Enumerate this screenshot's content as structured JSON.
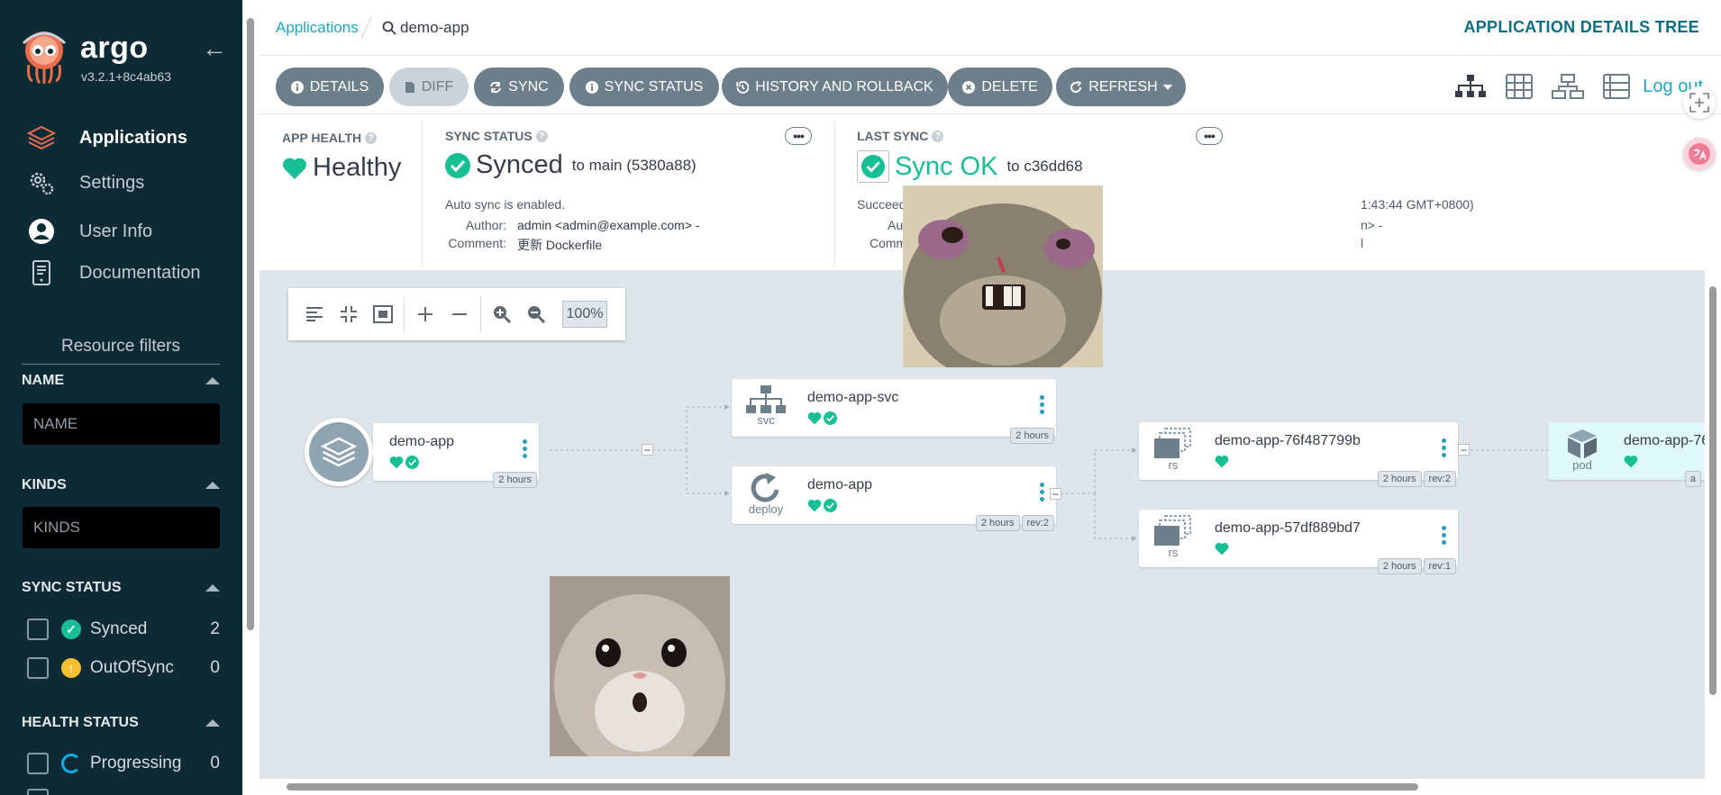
{
  "sidebar": {
    "brand": "argo",
    "version": "v3.2.1+8c4ab63",
    "nav": [
      {
        "label": "Applications"
      },
      {
        "label": "Settings"
      },
      {
        "label": "User Info"
      },
      {
        "label": "Documentation"
      }
    ],
    "filters_title": "Resource filters",
    "name_filter": {
      "heading": "NAME",
      "placeholder": "NAME"
    },
    "kinds_filter": {
      "heading": "KINDS",
      "placeholder": "KINDS"
    },
    "sync_status": {
      "heading": "SYNC STATUS",
      "items": [
        {
          "label": "Synced",
          "count": "2"
        },
        {
          "label": "OutOfSync",
          "count": "0"
        }
      ]
    },
    "health_status": {
      "heading": "HEALTH STATUS",
      "items": [
        {
          "label": "Progressing",
          "count": "0"
        }
      ]
    }
  },
  "topbar": {
    "breadcrumb_link": "Applications",
    "current_app": "demo-app",
    "heading": "APPLICATION DETAILS TREE"
  },
  "toolbar": {
    "buttons": [
      "DETAILS",
      "DIFF",
      "SYNC",
      "SYNC STATUS",
      "HISTORY AND ROLLBACK",
      "DELETE",
      "REFRESH"
    ],
    "logout": "Log out"
  },
  "status": {
    "health": {
      "label": "APP HEALTH",
      "value": "Healthy"
    },
    "sync": {
      "label": "SYNC STATUS",
      "value": "Synced",
      "detail": "to main (5380a88)",
      "auto": "Auto sync is enabled.",
      "author_key": "Author:",
      "author_val": "admin <admin@example.com> -",
      "comment_key": "Comment:",
      "comment_val": "更新 Dockerfile"
    },
    "last_sync": {
      "label": "LAST SYNC",
      "value": "Sync OK",
      "detail": "to c36dd68",
      "succeeded": "Succeeded",
      "time_fragment": "1:43:44 GMT+0800)",
      "author_key": "Aut",
      "author_fragment": "n> -",
      "comment_key": "Comm",
      "comment_fragment": "l"
    }
  },
  "graph": {
    "zoom": "100%",
    "nodes": [
      {
        "name": "demo-app",
        "kind": "",
        "age": "2 hours",
        "rev": ""
      },
      {
        "name": "demo-app-svc",
        "kind": "svc",
        "age": "2 hours",
        "rev": ""
      },
      {
        "name": "demo-app",
        "kind": "deploy",
        "age": "2 hours",
        "rev": "rev:2"
      },
      {
        "name": "demo-app-76f487799b",
        "kind": "rs",
        "age": "2 hours",
        "rev": "rev:2"
      },
      {
        "name": "demo-app-57df889bd7",
        "kind": "rs",
        "age": "2 hours",
        "rev": "rev:1"
      },
      {
        "name": "demo-app-76",
        "kind": "pod",
        "age": "a",
        "rev": ""
      }
    ]
  },
  "colors": {
    "sidebar_bg": "#0e2a35",
    "accent": "#1da7c3",
    "healthy": "#18be94",
    "out_of_sync": "#f4c030",
    "progressing": "#0dadea",
    "button": "#6d7f8b",
    "canvas_bg": "#dee6eb"
  }
}
